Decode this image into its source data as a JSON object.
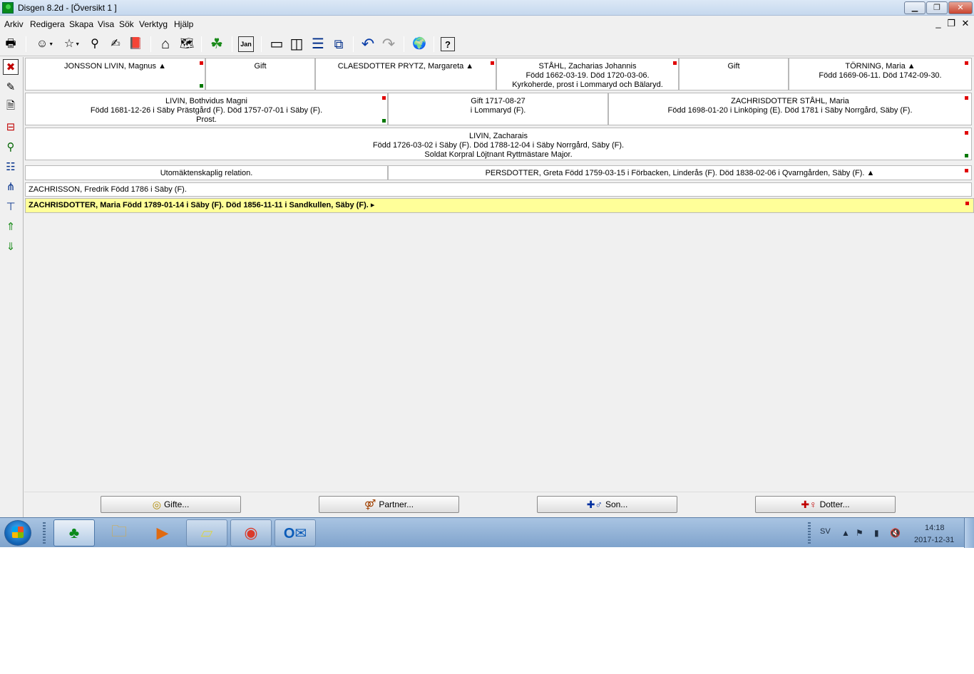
{
  "window": {
    "title": "Disgen 8.2d - [Översikt 1 ]",
    "min_glyph": "▁",
    "max_glyph": "❐",
    "close_glyph": "✕"
  },
  "menu": {
    "items": [
      "Arkiv",
      "Redigera",
      "Skapa",
      "Visa",
      "Sök",
      "Verktyg",
      "Hjälp"
    ],
    "mdi_min": "_",
    "mdi_restore": "❐",
    "mdi_close": "✕"
  },
  "toolbar": {
    "icons": [
      {
        "name": "print-icon",
        "glyph": "🖶"
      },
      {
        "name": "person-face-icon",
        "glyph": "☺"
      },
      {
        "name": "star-person-icon",
        "glyph": "☆"
      },
      {
        "name": "binoculars-icon",
        "glyph": "⚲"
      },
      {
        "name": "hand-notes-icon",
        "glyph": "✍"
      },
      {
        "name": "book-icon",
        "glyph": "📕"
      },
      {
        "name": "home-icon",
        "glyph": "⌂"
      },
      {
        "name": "map-book-icon",
        "glyph": "🗺"
      },
      {
        "name": "green-map-icon",
        "glyph": "☘"
      },
      {
        "name": "calendar-icon",
        "glyph": "Jan"
      },
      {
        "name": "single-window-icon",
        "glyph": "▭"
      },
      {
        "name": "split-vertical-icon",
        "glyph": "◫"
      },
      {
        "name": "split-horizontal-icon",
        "glyph": "☰"
      },
      {
        "name": "cascade-windows-icon",
        "glyph": "⧉"
      },
      {
        "name": "undo-icon",
        "glyph": "↶"
      },
      {
        "name": "redo-icon",
        "glyph": "↷"
      },
      {
        "name": "globe-icon",
        "glyph": "🌍"
      },
      {
        "name": "help-icon",
        "glyph": "?"
      }
    ]
  },
  "left_toolbar": {
    "icons": [
      {
        "name": "delete-x-icon",
        "glyph": "✖"
      },
      {
        "name": "edit-document-icon",
        "glyph": "✎"
      },
      {
        "name": "document-icon",
        "glyph": "🗎"
      },
      {
        "name": "descendants-chart-icon",
        "glyph": "⊟"
      },
      {
        "name": "family-search-icon",
        "glyph": "⚲"
      },
      {
        "name": "list-view-icon",
        "glyph": "☷"
      },
      {
        "name": "ancestor-tree-icon",
        "glyph": "⋔"
      },
      {
        "name": "descendant-tree-icon",
        "glyph": "⊤"
      },
      {
        "name": "search-up-icon",
        "glyph": "⇑"
      },
      {
        "name": "search-down-icon",
        "glyph": "⇓"
      }
    ]
  },
  "overview": {
    "row1": {
      "p1_name": "JONSSON LIVIN, Magnus ▲",
      "m1": "Gift",
      "p2_name": "CLAESDOTTER PRYTZ, Margareta ▲",
      "p3_name": "STÅHL, Zacharias Johannis",
      "p3_line2": "Född 1662-03-19. Död 1720-03-06.",
      "p3_line3": "Kyrkoherde, prost i Lommaryd och Bälaryd.",
      "m2": "Gift",
      "p4_name": "TÖRNING, Maria ▲",
      "p4_line2": "Född 1669-06-11. Död 1742-09-30."
    },
    "row2": {
      "father_name": "LIVIN, Bothvidus Magni",
      "father_line2": "Född 1681-12-26 i Säby Prästgård (F). Död 1757-07-01 i Säby (F).",
      "father_line3": "Prost.",
      "marriage_line1": "Gift 1717-08-27",
      "marriage_line2": "i Lommaryd (F).",
      "mother_name": "ZACHRISDOTTER STÅHL, Maria",
      "mother_line2": "Född 1698-01-20 i Linköping (E). Död 1781 i Säby Norrgård, Säby (F)."
    },
    "row3": {
      "name": "LIVIN, Zacharais",
      "line2": "Född 1726-03-02 i Säby (F). Död 1788-12-04 i Säby Norrgård, Säby (F).",
      "line3": "Soldat Korpral Löjtnant Ryttmästare Major."
    },
    "row4": {
      "relation": "Utomäktenskaplig relation.",
      "partner": "PERSDOTTER, Greta Född 1759-03-15 i Förbacken, Linderås (F). Död 1838-02-06 i Qvarngården, Säby (F). ▲"
    },
    "row5": {
      "child1": "ZACHRISSON, Fredrik Född 1786 i Säby (F)."
    },
    "row6": {
      "child2_selected": "ZACHRISDOTTER, Maria Född 1789-01-14 i Säby (F). Död 1856-11-11 i Sandkullen, Säby (F). ▸"
    }
  },
  "buttons": {
    "gifte": "Gifte...",
    "partner": "Partner...",
    "son": "Son...",
    "dotter": "Dotter..."
  },
  "taskbar": {
    "language": "SV",
    "time": "14:18",
    "date": "2017-12-31"
  },
  "colors": {
    "selected_row": "#ffff99",
    "marker_red": "#e00000",
    "marker_green": "#007800"
  }
}
